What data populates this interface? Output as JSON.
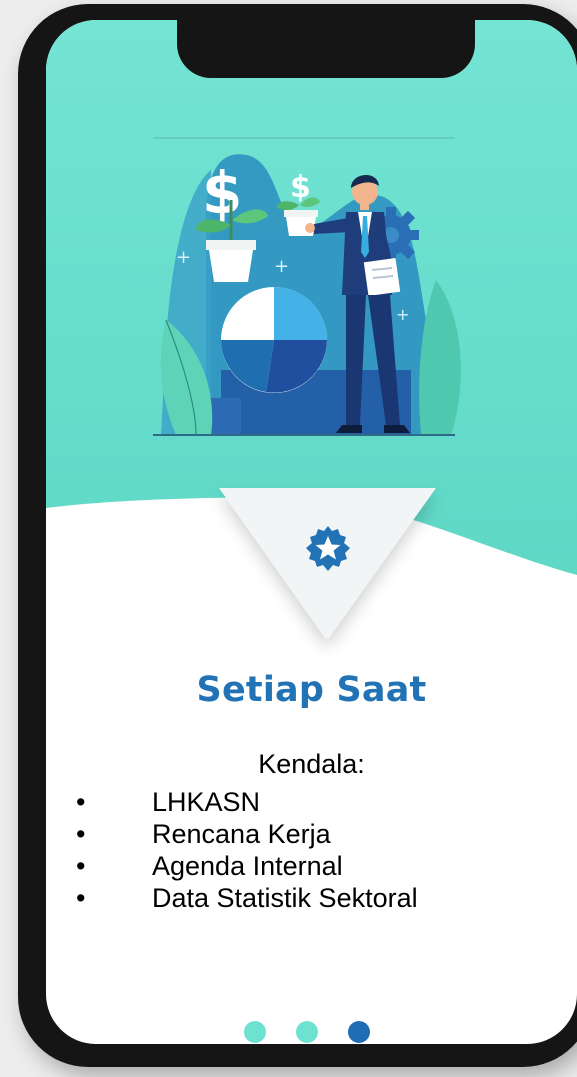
{
  "onboarding": {
    "title": "Setiap Saat",
    "subtitle": "Kendala:",
    "items": [
      "LHKASN",
      "Rencana Kerja",
      "Agenda Internal",
      "Data Statistik Sektoral"
    ],
    "bullet": "•",
    "illustration_icon": "businessman-growth-icon",
    "badge_icon": "star-badge-icon"
  },
  "pager": {
    "total": 3,
    "active_index": 2
  },
  "colors": {
    "header_bg": "#6ee2d0",
    "title": "#2273b5",
    "dot_inactive": "#6ee2d0",
    "dot_active": "#1f6db5",
    "phone_frame": "#151515"
  }
}
